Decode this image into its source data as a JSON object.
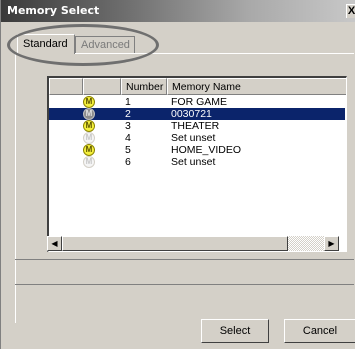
{
  "window": {
    "title": "Memory Select",
    "close_label": "X"
  },
  "tabs": [
    {
      "label": "Standard",
      "active": true
    },
    {
      "label": "Advanced",
      "active": false
    }
  ],
  "table": {
    "columns": [
      "",
      "Number",
      "Memory Name"
    ],
    "rows": [
      {
        "icon": "M",
        "icon_color": "yellow",
        "number": "1",
        "name": "FOR GAME",
        "selected": false
      },
      {
        "icon": "M",
        "icon_color": "gray",
        "number": "2",
        "name": "0030721",
        "selected": true
      },
      {
        "icon": "M",
        "icon_color": "yellow",
        "number": "3",
        "name": "THEATER",
        "selected": false
      },
      {
        "icon": "M",
        "icon_color": "white",
        "number": "4",
        "name": "Set unset",
        "selected": false
      },
      {
        "icon": "M",
        "icon_color": "yellow",
        "number": "5",
        "name": "HOME_VIDEO",
        "selected": false
      },
      {
        "icon": "M",
        "icon_color": "white",
        "number": "6",
        "name": "Set unset",
        "selected": false
      }
    ]
  },
  "buttons": {
    "select": "Select",
    "cancel": "Cancel"
  },
  "colors": {
    "selection": "#0b246b",
    "face": "#d4d0c8",
    "highlight_ring": "#6f6f6f"
  }
}
